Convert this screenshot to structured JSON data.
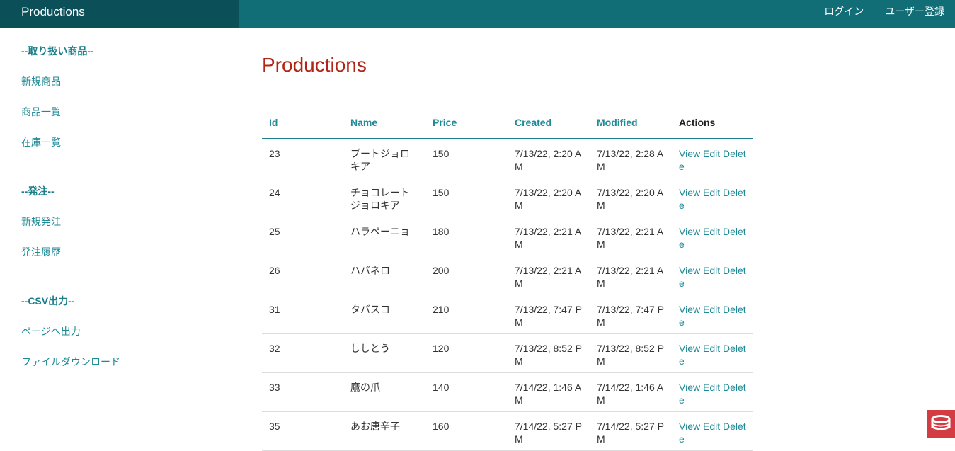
{
  "nav": {
    "brand": "Productions",
    "login": "ログイン",
    "register": "ユーザー登録"
  },
  "sidebar": {
    "sections": [
      {
        "heading": "--取り扱い商品--",
        "links": [
          "新規商品",
          "商品一覧",
          "在庫一覧"
        ]
      },
      {
        "heading": "--発注--",
        "links": [
          "新規発注",
          "発注履歴"
        ]
      },
      {
        "heading": "--CSV出力--",
        "links": [
          "ページへ出力",
          "ファイルダウンロード"
        ]
      }
    ]
  },
  "main": {
    "title": "Productions",
    "table": {
      "headers": {
        "id": "Id",
        "name": "Name",
        "price": "Price",
        "created": "Created",
        "modified": "Modified",
        "actions": "Actions"
      },
      "action_labels": {
        "view": "View",
        "edit": "Edit",
        "delete": "Delete"
      },
      "rows": [
        {
          "id": "23",
          "name": "ブートジョロキア",
          "price": "150",
          "created": "7/13/22, 2:20 AM",
          "modified": "7/13/22, 2:28 AM"
        },
        {
          "id": "24",
          "name": "チョコレートジョロキア",
          "price": "150",
          "created": "7/13/22, 2:20 AM",
          "modified": "7/13/22, 2:20 AM"
        },
        {
          "id": "25",
          "name": "ハラペーニョ",
          "price": "180",
          "created": "7/13/22, 2:21 AM",
          "modified": "7/13/22, 2:21 AM"
        },
        {
          "id": "26",
          "name": "ハバネロ",
          "price": "200",
          "created": "7/13/22, 2:21 AM",
          "modified": "7/13/22, 2:21 AM"
        },
        {
          "id": "31",
          "name": "タバスコ",
          "price": "210",
          "created": "7/13/22, 7:47 PM",
          "modified": "7/13/22, 7:47 PM"
        },
        {
          "id": "32",
          "name": "ししとう",
          "price": "120",
          "created": "7/13/22, 8:52 PM",
          "modified": "7/13/22, 8:52 PM"
        },
        {
          "id": "33",
          "name": "鷹の爪",
          "price": "140",
          "created": "7/14/22, 1:46 AM",
          "modified": "7/14/22, 1:46 AM"
        },
        {
          "id": "35",
          "name": "あお唐辛子",
          "price": "160",
          "created": "7/14/22, 5:27 PM",
          "modified": "7/14/22, 5:27 PM"
        }
      ]
    }
  },
  "colors": {
    "nav_bg": "#116d76",
    "brand_bg": "#0b5059",
    "accent": "#1f8a96",
    "title": "#b22416",
    "badge": "#d33c43"
  },
  "icons": {
    "corner_badge": "cakephp-logo-icon"
  }
}
